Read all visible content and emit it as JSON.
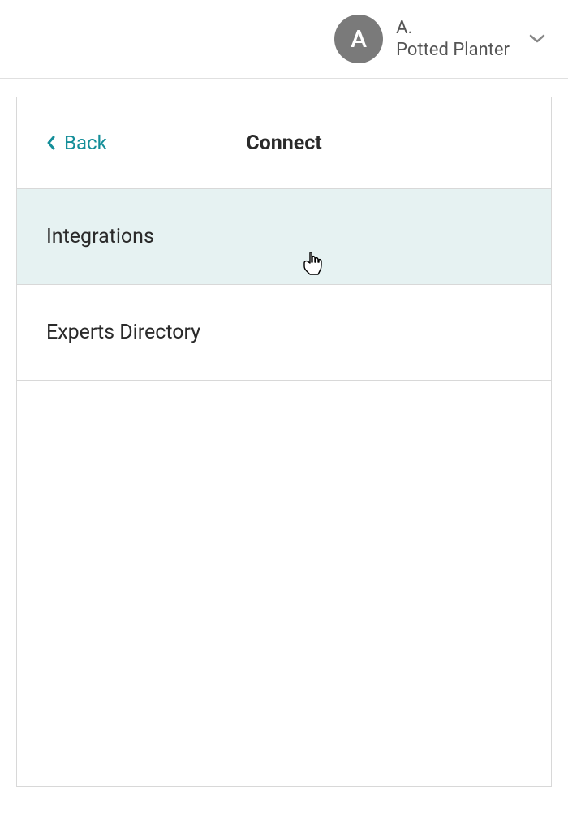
{
  "header": {
    "avatar_letter": "A",
    "user_line1": "A.",
    "user_line2": "Potted Planter"
  },
  "panel": {
    "back_label": "Back",
    "title": "Connect",
    "items": [
      {
        "label": "Integrations",
        "highlighted": true
      },
      {
        "label": "Experts Directory",
        "highlighted": false
      }
    ]
  },
  "colors": {
    "accent": "#148e99",
    "highlight_bg": "#e6f2f2",
    "avatar_bg": "#7a7a7a"
  }
}
